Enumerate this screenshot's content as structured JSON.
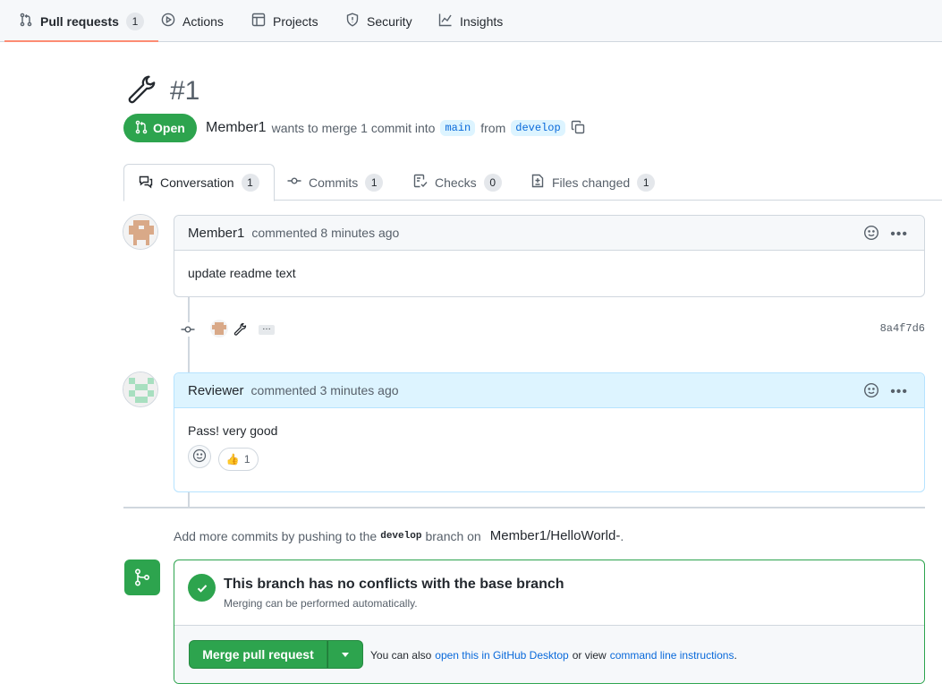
{
  "repo_nav": {
    "tabs": [
      {
        "label": "Pull requests",
        "count": "1",
        "icon": "git-pull-request-icon",
        "active": true
      },
      {
        "label": "Actions",
        "icon": "play-icon"
      },
      {
        "label": "Projects",
        "icon": "table-icon"
      },
      {
        "label": "Security",
        "icon": "shield-icon"
      },
      {
        "label": "Insights",
        "icon": "graph-icon"
      }
    ]
  },
  "pr": {
    "number": "#1",
    "title_icon": "wrench-icon",
    "state": "Open",
    "author": "Member1",
    "summary": "wants to merge 1 commit into",
    "base_branch": "main",
    "from_text": "from",
    "head_branch": "develop"
  },
  "pr_tabs": [
    {
      "label": "Conversation",
      "count": "1",
      "icon": "comment-discussion-icon",
      "active": true
    },
    {
      "label": "Commits",
      "count": "1",
      "icon": "git-commit-icon"
    },
    {
      "label": "Checks",
      "count": "0",
      "icon": "checklist-icon"
    },
    {
      "label": "Files changed",
      "count": "1",
      "icon": "file-diff-icon"
    }
  ],
  "comments": [
    {
      "author": "Member1",
      "time": "commented 8 minutes ago",
      "body": "update readme text"
    },
    {
      "author": "Reviewer",
      "time": "commented 3 minutes ago",
      "body": "Pass! very good",
      "reactions": [
        {
          "emoji": "👍",
          "count": "1"
        }
      ]
    }
  ],
  "commit": {
    "sha": "8a4f7d6",
    "expander": "…"
  },
  "push_hint": {
    "prefix": "Add more commits by pushing to the",
    "branch": "develop",
    "middle": "branch on",
    "repo": "Member1/HelloWorld-",
    "suffix": "."
  },
  "merge": {
    "title": "This branch has no conflicts with the base branch",
    "subtitle": "Merging can be performed automatically.",
    "button": "Merge pull request",
    "alt_prefix": "You can also",
    "alt_link1": "open this in GitHub Desktop",
    "alt_middle": "or view",
    "alt_link2": "command line instructions",
    "alt_suffix": "."
  },
  "colors": {
    "accent_green": "#2da44e",
    "link_blue": "#0969da",
    "tab_underline": "#fd8c73"
  }
}
